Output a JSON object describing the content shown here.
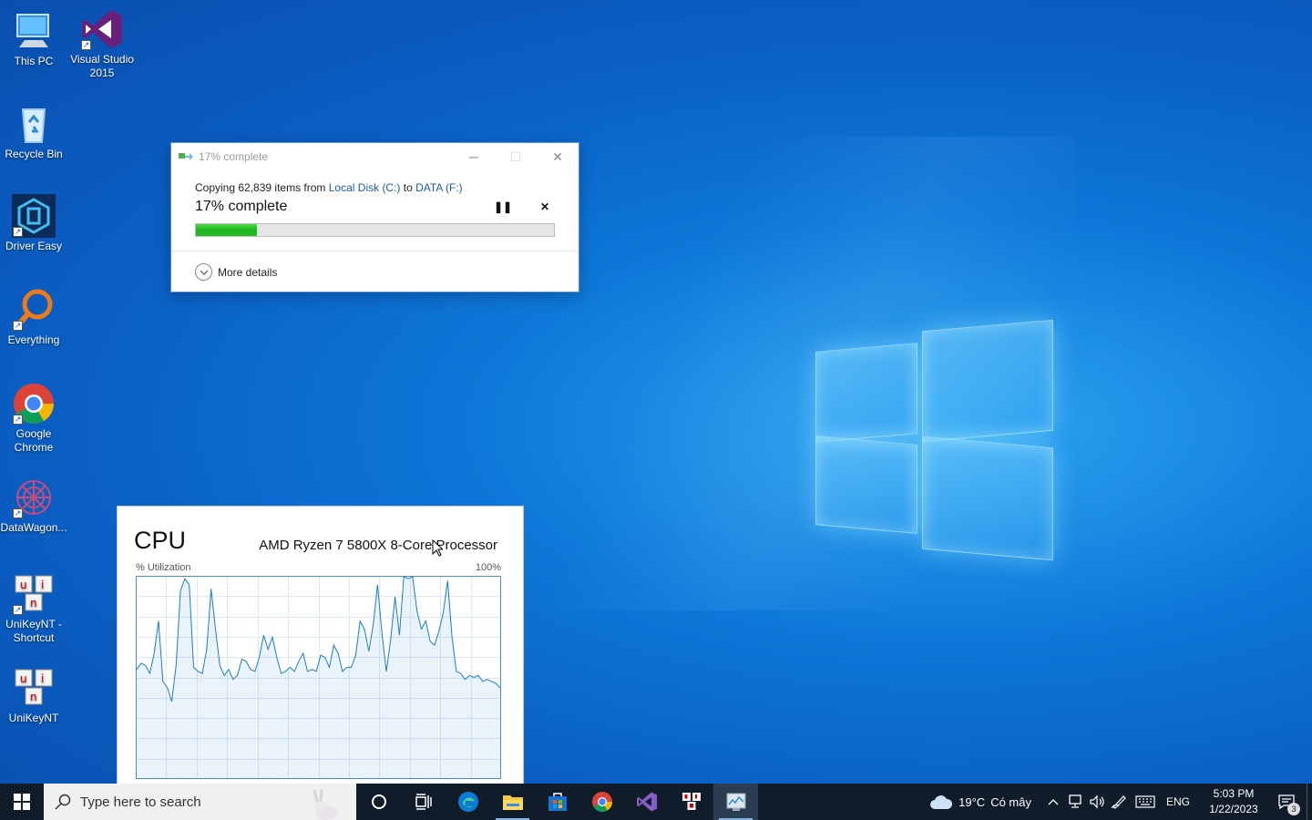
{
  "desktop": {
    "icons": [
      {
        "label": "This PC"
      },
      {
        "label": "Visual Studio 2015"
      },
      {
        "label": "Recycle Bin"
      },
      {
        "label": "Driver Easy"
      },
      {
        "label": "Everything"
      },
      {
        "label": "Google Chrome"
      },
      {
        "label": "DataWagon..."
      },
      {
        "label": "UniKeyNT - Shortcut"
      },
      {
        "label": "UniKeyNT"
      }
    ]
  },
  "copy_dialog": {
    "title": "17% complete",
    "copy_prefix": "Copying 62,839 items from ",
    "source": "Local Disk (C:)",
    "to_word": " to ",
    "destination": "DATA (F:)",
    "percent_text": "17% complete",
    "progress": 0.17,
    "more_details": "More details"
  },
  "cpu_panel": {
    "title": "CPU",
    "processor": "AMD Ryzen 7 5800X 8-Core Processor",
    "y_label": "% Utilization",
    "y_max_label": "100%"
  },
  "chart_data": {
    "type": "area",
    "ylim": [
      0,
      100
    ],
    "grid": true,
    "values": [
      54,
      57,
      56,
      52,
      62,
      78,
      48,
      45,
      38,
      56,
      93,
      99,
      96,
      55,
      53,
      52,
      64,
      94,
      74,
      56,
      51,
      54,
      49,
      51,
      59,
      58,
      54,
      53,
      60,
      71,
      64,
      70,
      60,
      52,
      53,
      55,
      53,
      58,
      62,
      53,
      54,
      53,
      61,
      60,
      55,
      66,
      62,
      53,
      55,
      55,
      61,
      78,
      74,
      63,
      76,
      96,
      72,
      53,
      69,
      90,
      71,
      100,
      99,
      100,
      83,
      74,
      78,
      68,
      66,
      73,
      82,
      98,
      70,
      53,
      52,
      49,
      51,
      50,
      51,
      48,
      49,
      48,
      47,
      45
    ]
  },
  "taskbar": {
    "search_placeholder": "Type here to search",
    "weather_temp": "19°C",
    "weather_desc": "Có mây",
    "language": "ENG",
    "time": "5:03 PM",
    "date": "1/22/2023",
    "notification_count": "3"
  }
}
